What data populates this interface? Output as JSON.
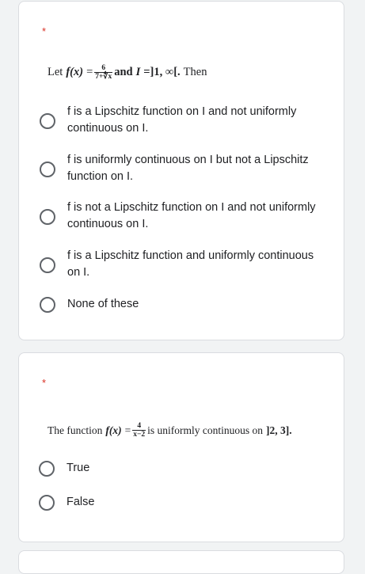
{
  "question1": {
    "required_mark": "*",
    "text_let": "Let",
    "func_name": "f(x)",
    "equals": "=",
    "frac_num": "6",
    "frac_den": "7+∜x",
    "text_and": "and",
    "interval_name": "I",
    "interval_value": "=]1, ∞[.",
    "text_then": "Then",
    "options": [
      "f is a Lipschitz function on I and not uniformly continuous on I.",
      "f is uniformly continuous on I but not a Lipschitz function on I.",
      "f is not a Lipschitz function on I and not uniformly continuous on I.",
      "f is a Lipschitz function and uniformly continuous on I.",
      "None of these"
    ]
  },
  "question2": {
    "required_mark": "*",
    "text_intro": "The function",
    "func_name": "f(x)",
    "equals": "=",
    "frac_num": "4",
    "frac_den": "x−2",
    "text_rest": "is uniformly continuous on",
    "interval": "]2, 3].",
    "options": [
      "True",
      "False"
    ]
  }
}
